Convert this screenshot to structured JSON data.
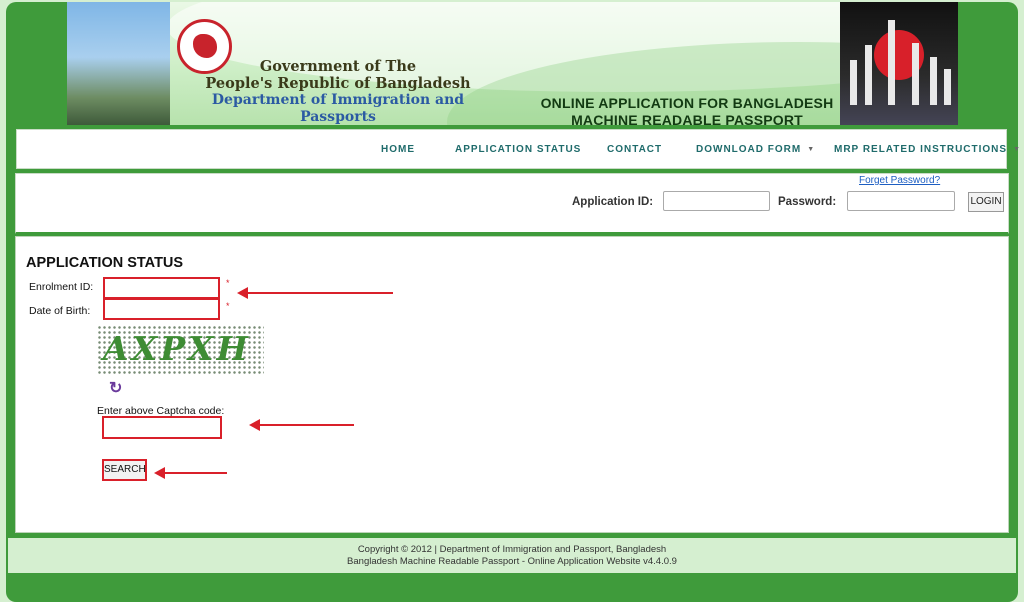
{
  "header": {
    "gov_line1": "Government of The",
    "gov_line2": "People's Republic of Bangladesh",
    "gov_line3": "Department of Immigration and Passports",
    "online_line1": "ONLINE APPLICATION FOR BANGLADESH",
    "online_line2": "MACHINE READABLE PASSPORT"
  },
  "nav": {
    "items": [
      {
        "label": "HOME"
      },
      {
        "label": "APPLICATION STATUS"
      },
      {
        "label": "CONTACT"
      },
      {
        "label": "DOWNLOAD FORM"
      },
      {
        "label": "MRP RELATED INSTRUCTIONS"
      }
    ]
  },
  "login": {
    "forget_password": "Forget Password?",
    "app_id_label": "Application ID:",
    "password_label": "Password:",
    "login_button": "LOGIN"
  },
  "form": {
    "title": "APPLICATION STATUS",
    "enrolment_label": "Enrolment ID:",
    "dob_label": "Date of Birth:",
    "required_mark": "*",
    "captcha_text": "AXPXH",
    "captcha_label": "Enter above Captcha code:",
    "search_button": "SEARCH"
  },
  "footer": {
    "line1": "Copyright © 2012 | Department of Immigration and Passport, Bangladesh",
    "line2": "Bangladesh Machine Readable Passport - Online Application Website v4.4.0.9"
  },
  "colors": {
    "accent_green": "#3f9b3b",
    "highlight_red": "#d9202a",
    "nav_text": "#1f6b6b"
  },
  "icons": {
    "refresh": "refresh-captcha-icon",
    "caret": "caret-down-icon"
  }
}
